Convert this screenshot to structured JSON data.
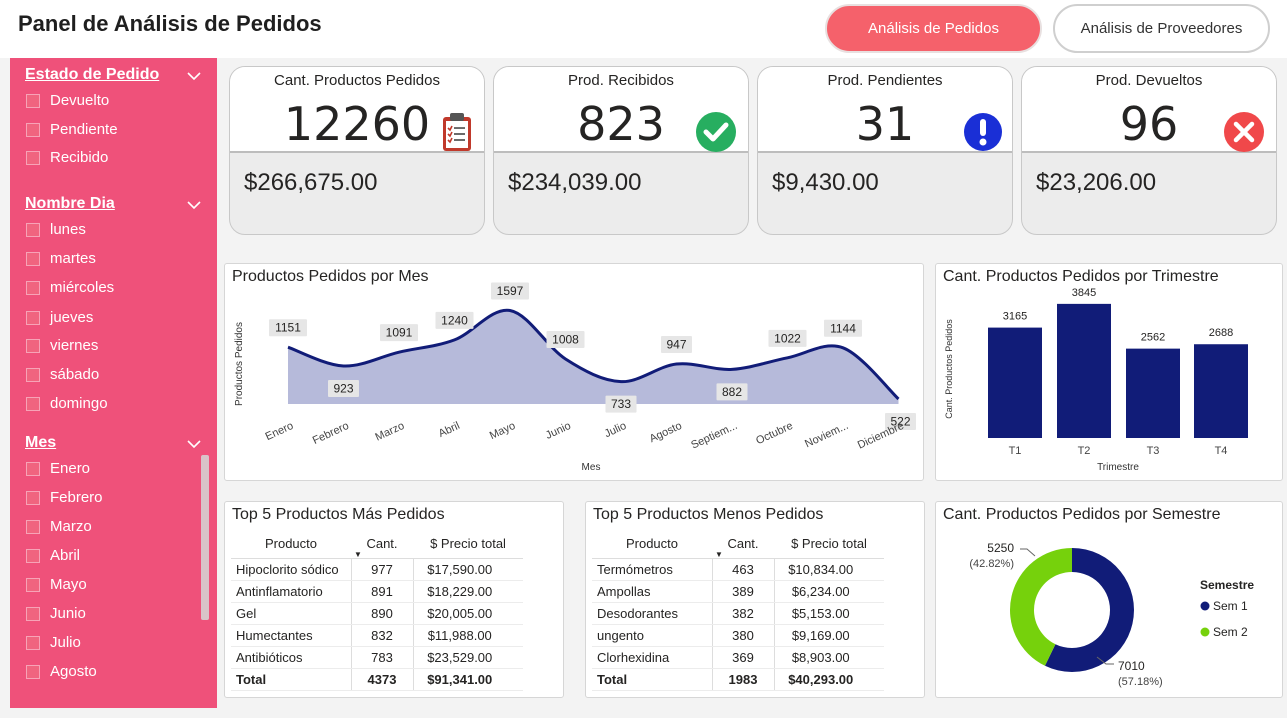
{
  "header": {
    "title": "Panel de Análisis de Pedidos",
    "tab_pedidos": "Análisis de Pedidos",
    "tab_proveedores": "Análisis de Proveedores"
  },
  "filters": {
    "estado": {
      "title": "Estado de Pedido",
      "options": [
        "Devuelto",
        "Pendiente",
        "Recibido"
      ]
    },
    "dia": {
      "title": "Nombre Dia",
      "options": [
        "lunes",
        "martes",
        "miércoles",
        "jueves",
        "viernes",
        "sábado",
        "domingo"
      ]
    },
    "mes": {
      "title": "Mes",
      "options": [
        "Enero",
        "Febrero",
        "Marzo",
        "Abril",
        "Mayo",
        "Junio",
        "Julio",
        "Agosto"
      ]
    }
  },
  "cards": [
    {
      "label": "Cant. Productos Pedidos",
      "value": "12260",
      "amount": "$266,675.00",
      "icon": "clipboard-icon"
    },
    {
      "label": "Prod. Recibidos",
      "value": "823",
      "amount": "$234,039.00",
      "icon": "check-circle-icon"
    },
    {
      "label": "Prod. Pendientes",
      "value": "31",
      "amount": "$9,430.00",
      "icon": "exclamation-circle-icon"
    },
    {
      "label": "Prod. Devueltos",
      "value": "96",
      "amount": "$23,206.00",
      "icon": "x-circle-icon"
    }
  ],
  "colors": {
    "accent": "#f5616b",
    "sidebar": "#ef517a",
    "navy": "#111c78",
    "area": "#a9aed4",
    "green": "#76d10c",
    "check": "#27ae60",
    "warn": "#1a2fd6",
    "error": "#f0484a"
  },
  "chart_data": [
    {
      "type": "area",
      "title": "Productos Pedidos por Mes",
      "xlabel": "Mes",
      "ylabel": "Productos Pedidos",
      "categories": [
        "Enero",
        "Febrero",
        "Marzo",
        "Abril",
        "Mayo",
        "Junio",
        "Julio",
        "Agosto",
        "Septiem...",
        "Octubre",
        "Noviem...",
        "Diciembre"
      ],
      "values": [
        1151,
        923,
        1091,
        1240,
        1597,
        1008,
        733,
        947,
        882,
        1022,
        1144,
        522
      ]
    },
    {
      "type": "bar",
      "title": "Cant. Productos Pedidos por Trimestre",
      "xlabel": "Trimestre",
      "ylabel": "Cant. Productos Pedidos",
      "categories": [
        "T1",
        "T2",
        "T3",
        "T4"
      ],
      "values": [
        3165,
        3845,
        2562,
        2688
      ]
    },
    {
      "type": "pie",
      "title": "Cant. Productos Pedidos por Semestre",
      "legend_title": "Semestre",
      "categories": [
        "Sem 1",
        "Sem 2"
      ],
      "values": [
        7010,
        5250
      ],
      "labels": [
        "7010",
        "5250"
      ],
      "percents": [
        "(57.18%)",
        "(42.82%)"
      ]
    }
  ],
  "top_mas": {
    "title": "Top 5 Productos Más Pedidos",
    "headers": [
      "Producto",
      "Cant.",
      "$ Precio total"
    ],
    "rows": [
      [
        "Hipoclorito sódico",
        "977",
        "$17,590.00"
      ],
      [
        "Antinflamatorio",
        "891",
        "$18,229.00"
      ],
      [
        "Gel",
        "890",
        "$20,005.00"
      ],
      [
        "Humectantes",
        "832",
        "$11,988.00"
      ],
      [
        "Antibióticos",
        "783",
        "$23,529.00"
      ]
    ],
    "total": [
      "Total",
      "4373",
      "$91,341.00"
    ]
  },
  "top_menos": {
    "title": "Top 5 Productos Menos Pedidos",
    "headers": [
      "Producto",
      "Cant.",
      "$ Precio total"
    ],
    "rows": [
      [
        "Termómetros",
        "463",
        "$10,834.00"
      ],
      [
        "Ampollas",
        "389",
        "$6,234.00"
      ],
      [
        "Desodorantes",
        "382",
        "$5,153.00"
      ],
      [
        "ungento",
        "380",
        "$9,169.00"
      ],
      [
        "Clorhexidina",
        "369",
        "$8,903.00"
      ]
    ],
    "total": [
      "Total",
      "1983",
      "$40,293.00"
    ]
  }
}
